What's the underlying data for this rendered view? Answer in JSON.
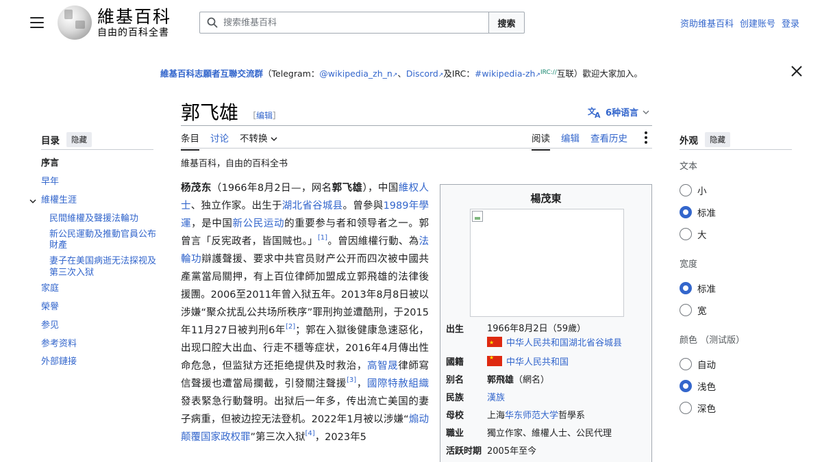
{
  "header": {
    "logo_title": "維基百科",
    "logo_subtitle": "自由的百科全書",
    "search_placeholder": "搜索维基百科",
    "search_button": "搜索",
    "links": [
      "资助维基百科",
      "创建账号",
      "登录"
    ]
  },
  "banner": {
    "title": "維基百科志願者互聯交流群",
    "open": "（Telegram：",
    "telegram": "@wikipedia_zh_n",
    "sep1": "、",
    "discord": "Discord",
    "and": "及IRC：",
    "irc": "#wikipedia-zh",
    "irc_sup": "IRC://",
    "close": "互联）歡迎大家加入。"
  },
  "page": {
    "title": "郭飞雄",
    "edit_open": "［",
    "edit": "编辑",
    "edit_close": "］",
    "languages": "6种语言",
    "tagline": "維基百科，自由的百科全书"
  },
  "tabs": {
    "left": [
      "条目",
      "讨论",
      "不转换"
    ],
    "right": [
      "阅读",
      "编辑",
      "查看历史"
    ]
  },
  "toc": {
    "heading": "目录",
    "hide": "隐藏",
    "items": [
      "序言",
      "早年",
      "維權生涯",
      "民間維權及聲援法輪功",
      "新公民運動及推動官員公布財產",
      "妻子在美国病逝无法探视及第三次入狱",
      "家庭",
      "榮譽",
      "参见",
      "参考资料",
      "外部鏈接"
    ]
  },
  "body": {
    "p1": "杨茂东",
    "p2": "（1966年8月2日—，网名",
    "p3": "郭飞雄",
    "p4": "），中国",
    "l1": "維权人士",
    "p5": "、独立作家。出生于",
    "l2": "湖北省谷城县",
    "p6": "。曾參與",
    "l3": "1989年學運",
    "p7": "，是中国",
    "l4": "新公民运动",
    "p8": "的重要参与者和领导者之一。郭曾言「反宪政者，皆国贼也。」",
    "r1": "[1]",
    "p9": "。曾因維權行動、為",
    "l5": "法輪功",
    "p10": "辯護聲援、要求中共官员财产公开而四次被中國共產黨當局關押，有上百位律師加盟成立郭飛雄的法律後援團。2006至2011年曾入狱五年。2013年8月8日被以涉嫌“聚众扰乱公共场所秩序”罪刑拘並遭酷刑，于2015年11月27日被判刑6年",
    "r2": "[2]",
    "p11": "；郭在入獄後健康急速惡化，出现口腔大出血、行走不穩等症状，2016年4月傳出性命危急，但监狱方还拒绝提供及时救治，",
    "l6": "高智晟",
    "p12": "律師寫信聲援也遭當局攔截，引發關注聲援",
    "r3": "[3]",
    "p13": "，",
    "l7": "國際特赦組織",
    "p14": "發表緊急行動聲明。出狱后一年多，传出流亡美国的妻子病重，但被边控无法登机。2022年1月被以涉嫌“",
    "l8": "煽动颠覆国家政权罪",
    "p15": "”第三次入狱",
    "r4": "[4]",
    "p16": "，2023年5"
  },
  "infobox": {
    "title": "楊茂東",
    "rows": [
      {
        "label": "出生",
        "v1": "1966年8月2日（59歲）",
        "v2": "中华人民共和国湖北省谷城县"
      },
      {
        "label": "國籍",
        "v1": "中华人民共和国"
      },
      {
        "label": "别名",
        "v1a": "郭飛雄",
        "v1b": "（網名）"
      },
      {
        "label": "民族",
        "v1": "漢族"
      },
      {
        "label": "母校",
        "v1a": "上海",
        "v1b": "华东师范大学",
        "v1c": "哲學系"
      },
      {
        "label": "職业",
        "v1": "獨立作家、維權人士、公民代理"
      },
      {
        "label": "活跃时期",
        "v1": "2005年至今"
      }
    ]
  },
  "appearance": {
    "heading": "外观",
    "hide": "隐藏",
    "text_label": "文本",
    "text_opts": [
      "小",
      "标准",
      "大"
    ],
    "width_label": "宽度",
    "width_opts": [
      "标准",
      "宽"
    ],
    "color_label": "颜色 （测试版）",
    "color_opts": [
      "自动",
      "浅色",
      "深色"
    ],
    "accent": "#3366cc"
  }
}
